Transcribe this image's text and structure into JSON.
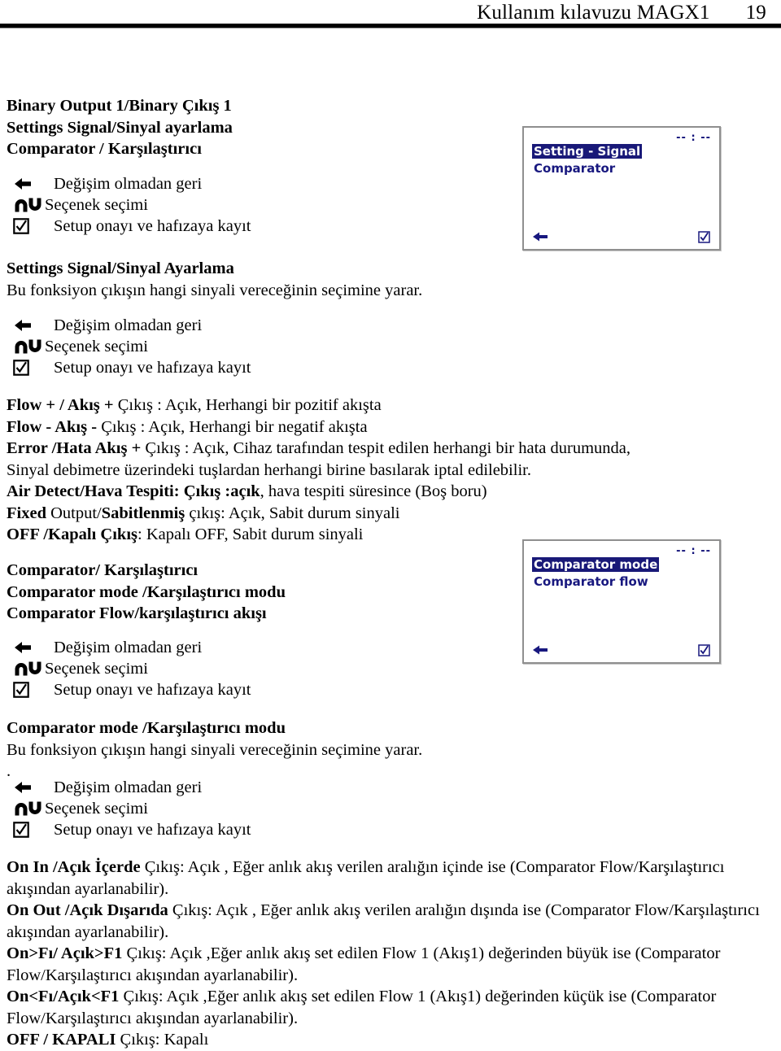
{
  "header": {
    "title": "Kullanım kılavuzu MAGX1",
    "page_number": "19"
  },
  "sections": {
    "binary_output": {
      "heading_line_1": "Binary Output 1/Binary Çıkış 1",
      "heading_line_2": "Settings Signal/Sinyal ayarlama",
      "heading_line_3": "Comparator / Karşılaştırıcı"
    },
    "settings_signal": {
      "heading": "Settings Signal/Sinyal Ayarlama",
      "description": "Bu fonksiyon çıkışın hangi sinyali vereceğinin seçimine yarar."
    },
    "comparator_intro": {
      "heading_line_1": "Comparator/ Karşılaştırıcı",
      "heading_line_2": "Comparator mode /Karşılaştırıcı modu",
      "heading_line_3": "Comparator Flow/karşılaştırıcı akışı"
    },
    "comparator_mode": {
      "heading": "Comparator mode /Karşılaştırıcı modu",
      "description": "Bu fonksiyon çıkışın hangi sinyali vereceğinin seçimine yarar.",
      "stray_dot": "."
    }
  },
  "key_legend": {
    "back": "Değişim olmadan geri",
    "select": "Seçenek seçimi",
    "confirm": "Setup onayı ve hafızaya kayıt",
    "icons": {
      "back": "left-arrow-icon",
      "select": "up-down-keys-icon",
      "confirm": "checked-checkbox-icon"
    }
  },
  "signal_options": [
    {
      "bold": "Flow + / Akış + ",
      "rest": "Çıkış : Açık,  Herhangi bir pozitif akışta"
    },
    {
      "bold": "Flow - Akış - ",
      "rest": " Çıkış : Açık,  Herhangi bir negatif akışta"
    },
    {
      "bold": "Error /Hata Akış + ",
      "rest": "Çıkış : Açık,  Cihaz tarafından tespit edilen herhangi bir hata durumunda,"
    },
    {
      "bold": "",
      "rest": "Sinyal debimetre üzerindeki tuşlardan herhangi birine basılarak iptal edilebilir."
    },
    {
      "bold": "Air Detect/Hava Tespiti:  Çıkış :açık",
      "rest": ", hava tespiti süresince (Boş boru)"
    },
    {
      "bold": "Fixed",
      "mid": " Output/",
      "bold2": "Sabitlenmiş",
      "rest": " çıkış: Açık,  Sabit durum sinyali"
    },
    {
      "bold": "OFF /Kapalı  Çıkış",
      "rest": ": Kapalı OFF, Sabit durum sinyali"
    }
  ],
  "comparator_options": [
    {
      "bold": "On In /Açık İçerde ",
      "rest": "Çıkış: Açık , Eğer anlık akış verilen aralığın içinde ise (Comparator Flow/Karşılaştırıcı akışından ayarlanabilir)."
    },
    {
      "bold": "On Out /Açık Dışarıda ",
      "rest": "Çıkış: Açık , Eğer anlık akış verilen aralığın dışında  ise (Comparator Flow/Karşılaştırıcı akışından ayarlanabilir)."
    },
    {
      "bold": "On>Fı/ Açık>F1 ",
      "rest": "Çıkış: Açık ,Eğer anlık akış set edilen Flow 1 (Akış1) değerinden büyük ise  (Comparator Flow/Karşılaştırıcı akışından ayarlanabilir)."
    },
    {
      "bold": "On<Fı/Açık<F1 ",
      "rest": "Çıkış: Açık ,Eğer anlık akış set edilen Flow 1 (Akış1) değerinden küçük ise  (Comparator Flow/Karşılaştırıcı akışından ayarlanabilir)."
    },
    {
      "bold": "OFF / KAPALI ",
      "rest": "Çıkış: Kapalı"
    }
  ],
  "lcd_screens": [
    {
      "name": "setting-signal-screen",
      "clock": "-- : --",
      "items": [
        {
          "label": "Setting - Signal",
          "selected": true
        },
        {
          "label": "Comparator",
          "selected": false
        }
      ],
      "back_icon": "left-arrow-icon",
      "ok_icon": "checked-checkbox-icon"
    },
    {
      "name": "comparator-mode-screen",
      "clock": "-- : --",
      "items": [
        {
          "label": "Comparator mode",
          "selected": true
        },
        {
          "label": "Comparator flow",
          "selected": false
        }
      ],
      "back_icon": "left-arrow-icon",
      "ok_icon": "checked-checkbox-icon"
    }
  ],
  "colors": {
    "lcd_text": "#18187f",
    "lcd_highlight_bg": "#191978",
    "lcd_highlight_text": "#ffffff",
    "lcd_border": "#8f8f8f"
  }
}
